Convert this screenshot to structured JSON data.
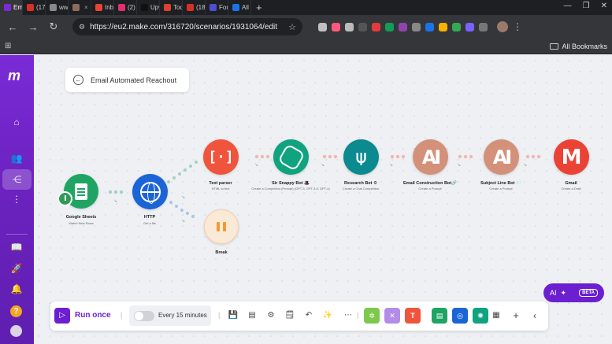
{
  "browser": {
    "tabs": [
      {
        "label": "Ema",
        "color": "#7a2bd6",
        "active": true
      },
      {
        "label": "(17",
        "color": "#d93025"
      },
      {
        "label": "www",
        "color": "#888888"
      },
      {
        "label": "",
        "color": "#8a6d5b"
      },
      {
        "label": "Inbo",
        "color": "#ea4335"
      },
      {
        "label": "(2) I",
        "color": "#e1306c"
      },
      {
        "label": "Upw",
        "color": "#111111"
      },
      {
        "label": "Tod",
        "color": "#db4035"
      },
      {
        "label": "(18)",
        "color": "#d93025"
      },
      {
        "label": "Fon",
        "color": "#4a4fd6"
      },
      {
        "label": "All D",
        "color": "#1a73e8"
      }
    ],
    "url": "https://eu2.make.com/316720/scenarios/1931064/edit",
    "all_bookmarks": "All Bookmarks",
    "extension_colors": [
      "#c0c0c0",
      "#ff5a79",
      "#bbbbbb",
      "#555555",
      "#e23b3b",
      "#0f9d58",
      "#8e44ad",
      "#888888",
      "#1a73e8",
      "#f4b400",
      "#34a853",
      "#7b61ff",
      "#777777"
    ]
  },
  "sidebar": {
    "logo": "m",
    "icons": [
      "home-icon",
      "users-icon",
      "share-icon",
      "more-icon",
      "book-icon",
      "rocket-icon",
      "bell-icon",
      "help-icon",
      "avatar"
    ],
    "help_label": "?"
  },
  "scenario": {
    "title": "Email Automated Reachout"
  },
  "modules": {
    "google_sheets": {
      "label": "Google Sheets",
      "sub": "Watch New Rows",
      "color": "#1fa463"
    },
    "http": {
      "label": "HTTP",
      "sub": "Get a file",
      "color": "#1b64d8"
    },
    "text_parser": {
      "label": "Text parser",
      "sub": "HTML to text",
      "color": "#f0543c",
      "glyph": "[·]"
    },
    "snappy_bot": {
      "label": "Sir Snappy Bot 🎩",
      "sub": "Create a Completion (Prompt) (GPT-3, GPT-3.5, GPT-4)",
      "color": "#10a37f"
    },
    "research_bot": {
      "label": "Research Bot ⚙",
      "sub": "Create a Chat Completion",
      "color": "#0b8a8f",
      "glyph": "⍦"
    },
    "email_bot": {
      "label": "Email Construction Bot🔗",
      "sub": "Create a Prompt",
      "color": "#d4917a",
      "glyph": "AI"
    },
    "subject_bot": {
      "label": "Subject Line Bot 📨",
      "sub": "Create a Prompt",
      "color": "#d4917a",
      "glyph": "AI"
    },
    "gmail": {
      "label": "Gmail",
      "sub": "Create a Draft",
      "color": "#ea4335",
      "glyph": "M"
    },
    "break": {
      "label": "Break",
      "color": "#fbe9d8"
    }
  },
  "ai_assist": {
    "label": "AI",
    "badge": "BETA"
  },
  "controls": {
    "run_once": "Run once",
    "schedule": "Every 15 minutes",
    "tools": [
      "save-icon",
      "scenario-settings-icon",
      "settings-icon",
      "notes-icon",
      "undo-icon",
      "magic-wand-icon",
      "more-icon"
    ],
    "colored": [
      {
        "name": "tools-button",
        "color": "#7ec84c",
        "glyph": "✲"
      },
      {
        "name": "flow-control-button",
        "color": "#b38be8",
        "glyph": "✕"
      },
      {
        "name": "text-parser-button",
        "color": "#f0543c",
        "glyph": "T"
      },
      {
        "name": "sheets-button",
        "color": "#1fa463",
        "glyph": "▤"
      },
      {
        "name": "http-button",
        "color": "#1b64d8",
        "glyph": "◎"
      },
      {
        "name": "openai-button",
        "color": "#10a37f",
        "glyph": "✺"
      }
    ]
  }
}
